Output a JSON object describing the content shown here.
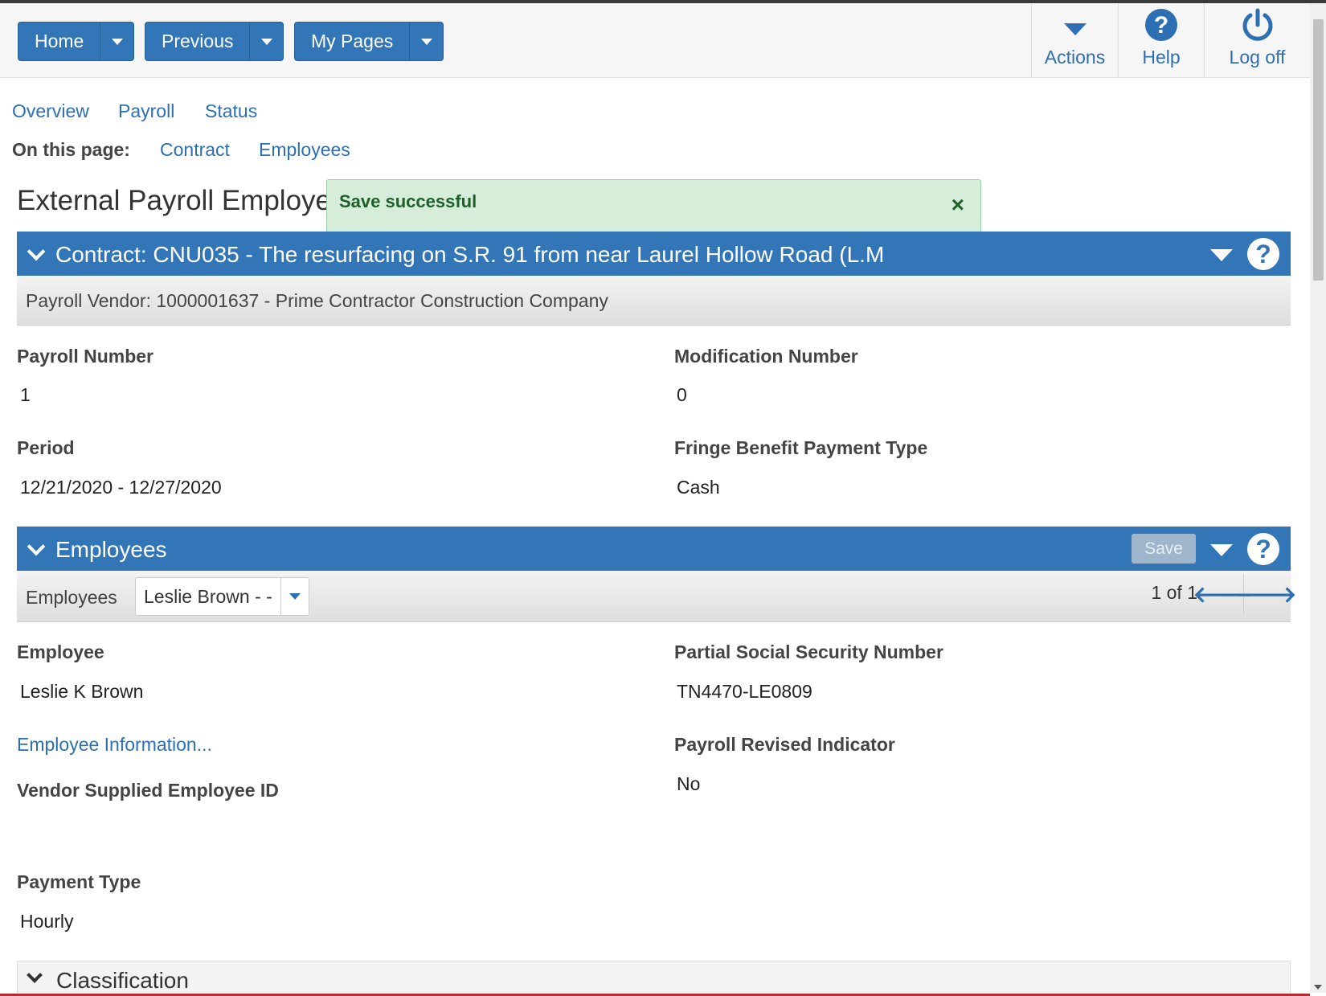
{
  "header": {
    "nav": [
      {
        "label": "Home"
      },
      {
        "label": "Previous"
      },
      {
        "label": "My Pages"
      }
    ],
    "actions": {
      "label": "Actions"
    },
    "help": {
      "label": "Help"
    },
    "logoff": {
      "label": "Log off"
    }
  },
  "tabs": [
    "Overview",
    "Payroll",
    "Status"
  ],
  "on_this_page": {
    "label": "On this page:",
    "links": [
      "Contract",
      "Employees"
    ]
  },
  "page_title": "External Payroll Employe",
  "toast": {
    "message": "Save successful",
    "close": "×"
  },
  "contract_panel": {
    "title": "Contract: CNU035 - The resurfacing on S.R. 91 from near Laurel Hollow Road (L.M",
    "vendor": "Payroll Vendor: 1000001637 - Prime Contractor Construction Company"
  },
  "fields": {
    "payroll_number": {
      "label": "Payroll Number",
      "value": "1"
    },
    "modification_number": {
      "label": "Modification Number",
      "value": "0"
    },
    "period": {
      "label": "Period",
      "value": "12/21/2020 - 12/27/2020"
    },
    "fringe": {
      "label": "Fringe Benefit Payment Type",
      "value": "Cash"
    }
  },
  "employees_panel": {
    "title": "Employees",
    "save_label": "Save",
    "selector_label": "Employees",
    "selected": "Leslie Brown - -",
    "pager": "1 of 1",
    "prev_arrow": "🡐",
    "next_arrow": "🡒"
  },
  "employee_fields": {
    "employee": {
      "label": "Employee",
      "value": "Leslie K Brown"
    },
    "ssn": {
      "label": "Partial Social Security Number",
      "value": "TN4470-LE0809"
    },
    "info_link": "Employee Information...",
    "revised": {
      "label": "Payroll Revised Indicator",
      "value": "No"
    },
    "vendor_id": {
      "label": "Vendor Supplied Employee ID",
      "value": ""
    },
    "payment_type": {
      "label": "Payment Type",
      "value": "Hourly"
    }
  },
  "classification": {
    "title": "Classification"
  }
}
